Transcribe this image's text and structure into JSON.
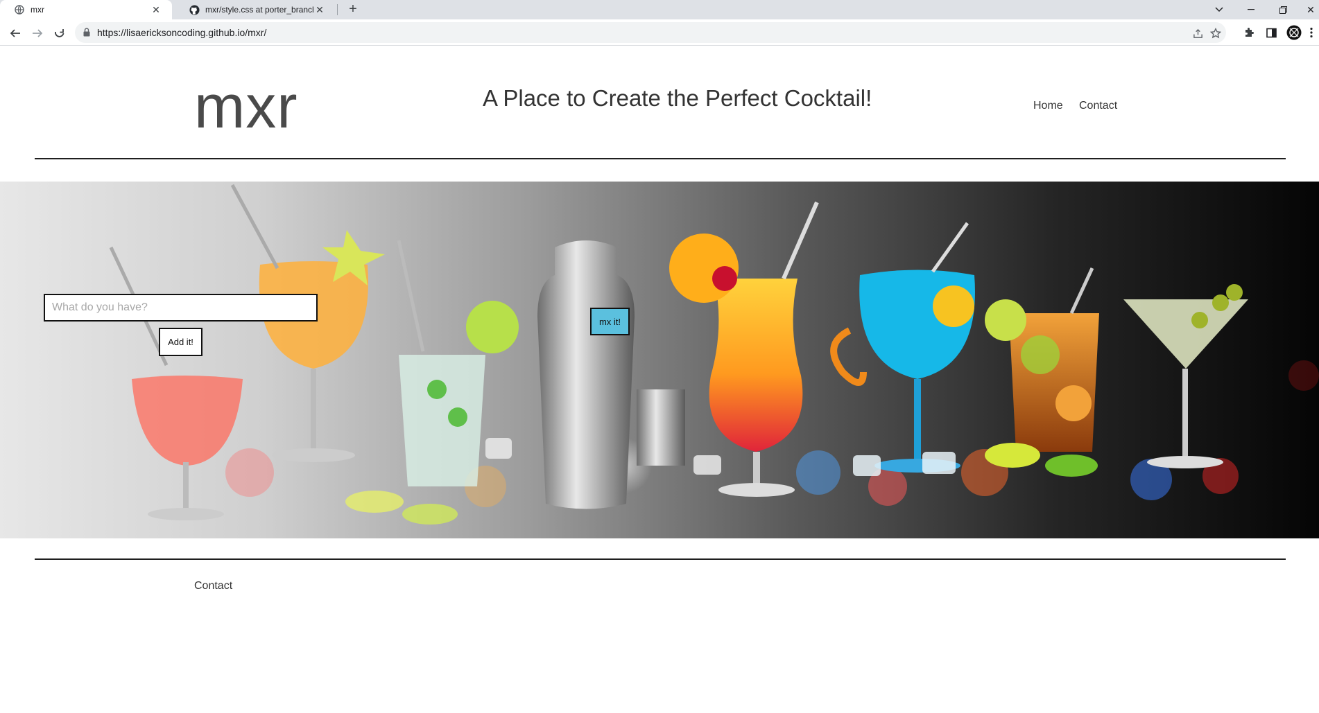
{
  "browser": {
    "tabs": [
      {
        "title": "mxr",
        "active": true
      },
      {
        "title": "mxr/style.css at porter_branch · li",
        "active": false
      }
    ],
    "url": "https://lisaericksoncoding.github.io/mxr/"
  },
  "site": {
    "logo": "mxr",
    "tagline": "A Place to Create the Perfect Cocktail!",
    "nav": {
      "home": "Home",
      "contact": "Contact"
    }
  },
  "form": {
    "search_placeholder": "What do you have?",
    "add_label": "Add it!",
    "mix_label": "mx it!"
  },
  "footer": {
    "contact": "Contact"
  },
  "colors": {
    "mix_button": "#5bc0de",
    "text": "#333333",
    "rule": "#1f1f1f"
  }
}
